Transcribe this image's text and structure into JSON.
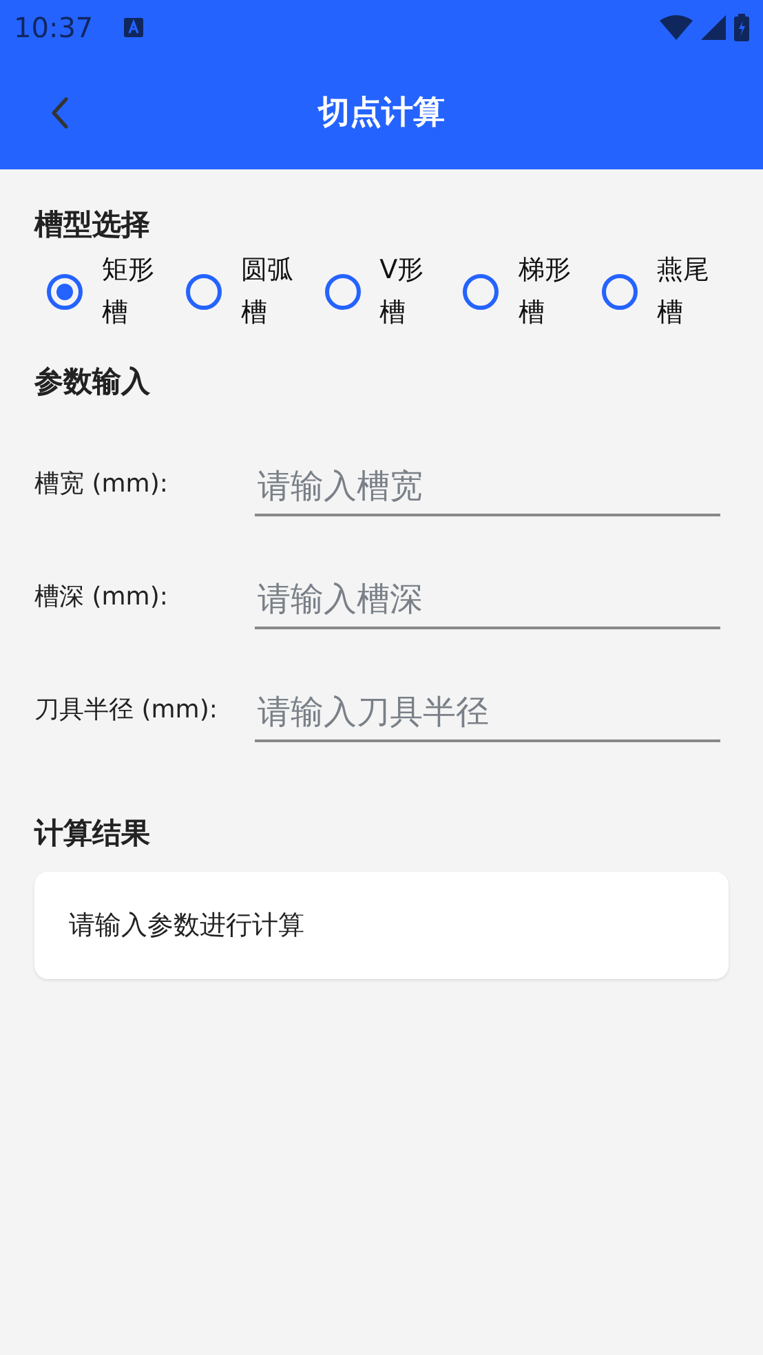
{
  "status_bar": {
    "time": "10:37"
  },
  "app_bar": {
    "title": "切点计算"
  },
  "groove_section": {
    "title": "槽型选择",
    "options": [
      {
        "label": "矩形槽",
        "selected": true
      },
      {
        "label": "圆弧槽",
        "selected": false
      },
      {
        "label": "V形槽",
        "selected": false
      },
      {
        "label": "梯形槽",
        "selected": false
      },
      {
        "label": "燕尾槽",
        "selected": false
      }
    ]
  },
  "params_section": {
    "title": "参数输入",
    "fields": [
      {
        "label": "槽宽 (mm):",
        "placeholder": "请输入槽宽"
      },
      {
        "label": "槽深 (mm):",
        "placeholder": "请输入槽深"
      },
      {
        "label": "刀具半径 (mm):",
        "placeholder": "请输入刀具半径"
      }
    ]
  },
  "result_section": {
    "title": "计算结果",
    "message": "请输入参数进行计算"
  }
}
